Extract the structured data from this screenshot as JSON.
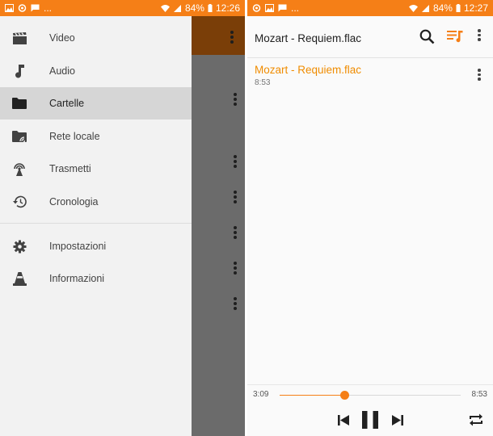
{
  "left_screen": {
    "status_bar": {
      "notification_icons": [
        "image-icon",
        "sync-icon",
        "message-icon"
      ],
      "overflow": "...",
      "battery": "84%",
      "time": "12:26"
    },
    "drawer": {
      "items": [
        {
          "label": "Video",
          "icon": "video-icon",
          "active": false
        },
        {
          "label": "Audio",
          "icon": "music-note-icon",
          "active": false
        },
        {
          "label": "Cartelle",
          "icon": "folder-icon",
          "active": true
        },
        {
          "label": "Rete locale",
          "icon": "network-folder-icon",
          "active": false
        },
        {
          "label": "Trasmetti",
          "icon": "broadcast-icon",
          "active": false
        },
        {
          "label": "Cronologia",
          "icon": "history-icon",
          "active": false
        }
      ],
      "secondary_items": [
        {
          "label": "Impostazioni",
          "icon": "gear-icon"
        },
        {
          "label": "Informazioni",
          "icon": "vlc-cone-icon"
        }
      ]
    }
  },
  "right_screen": {
    "status_bar": {
      "notification_icons": [
        "sync-icon",
        "image-icon",
        "message-icon"
      ],
      "overflow": "...",
      "battery": "84%",
      "time": "12:27"
    },
    "toolbar": {
      "title": "Mozart - Requiem.flac",
      "icons": [
        "search-icon",
        "playlist-icon",
        "more-vert-icon"
      ]
    },
    "tracks": [
      {
        "title": "Mozart - Requiem.flac",
        "duration": "8:53"
      }
    ],
    "player": {
      "elapsed": "3:09",
      "total": "8:53",
      "progress": 0.355,
      "controls": [
        "previous-icon",
        "pause-icon",
        "next-icon",
        "repeat-icon"
      ]
    }
  },
  "colors": {
    "accent": "#f57f17",
    "track_title": "#f08c00",
    "drawer_active": "#d6d6d6"
  }
}
